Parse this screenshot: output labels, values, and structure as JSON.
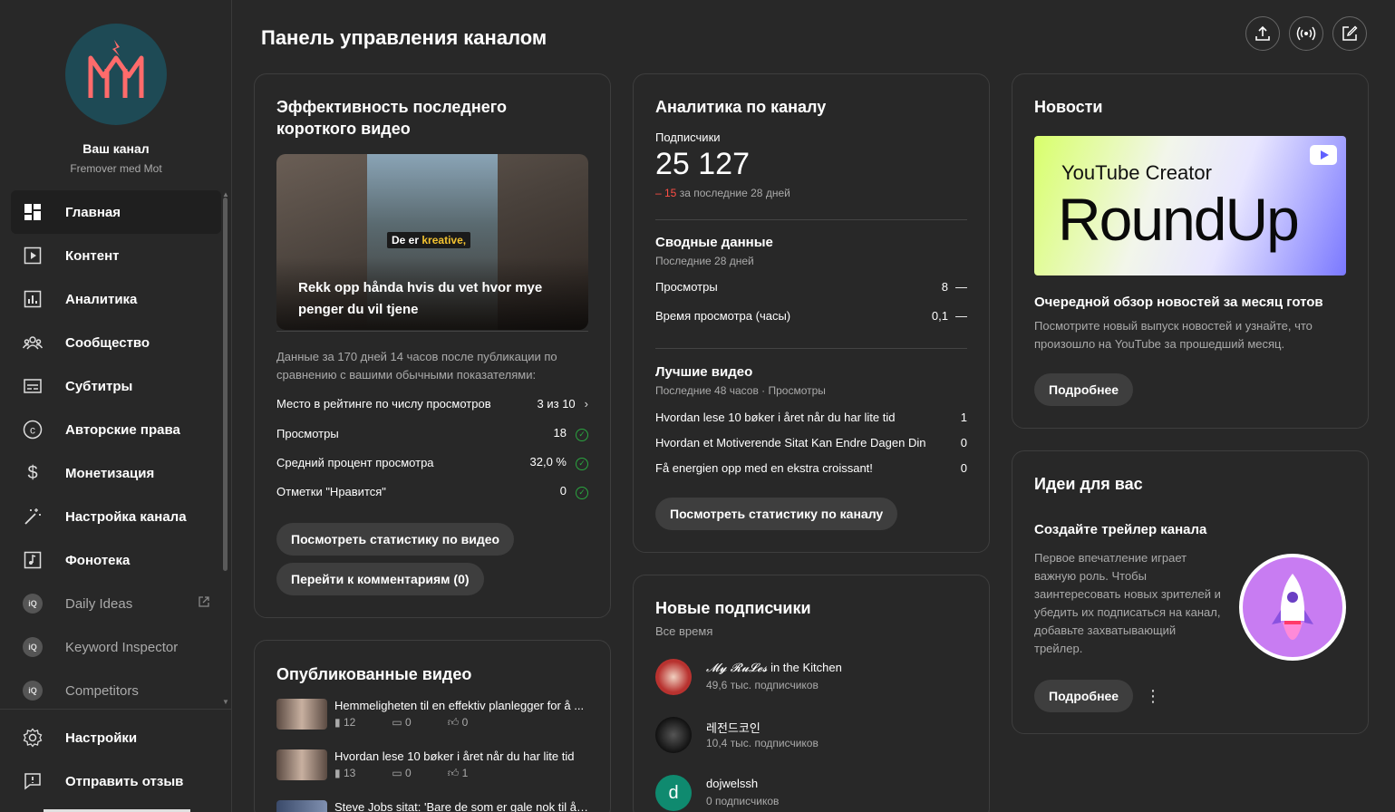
{
  "channel": {
    "name": "Ваш канал",
    "handle": "Fremover med Mot"
  },
  "nav": [
    {
      "label": "Главная",
      "icon": "dashboard-icon",
      "active": true
    },
    {
      "label": "Контент",
      "icon": "content-icon"
    },
    {
      "label": "Аналитика",
      "icon": "analytics-icon"
    },
    {
      "label": "Сообщество",
      "icon": "community-icon"
    },
    {
      "label": "Субтитры",
      "icon": "subtitles-icon"
    },
    {
      "label": "Авторские права",
      "icon": "copyright-icon"
    },
    {
      "label": "Монетизация",
      "icon": "monetization-icon"
    },
    {
      "label": "Настройка канала",
      "icon": "customization-icon"
    },
    {
      "label": "Фонотека",
      "icon": "audio-library-icon"
    },
    {
      "label": "Daily Ideas",
      "icon": "vidiq-icon",
      "external": true
    },
    {
      "label": "Keyword Inspector",
      "icon": "vidiq-icon"
    },
    {
      "label": "Competitors",
      "icon": "vidiq-icon"
    }
  ],
  "nav_bottom": [
    {
      "label": "Настройки",
      "icon": "settings-icon"
    },
    {
      "label": "Отправить отзыв",
      "icon": "feedback-icon"
    }
  ],
  "ext_badge": "iQ",
  "header": {
    "title": "Панель управления каналом"
  },
  "short_perf": {
    "title": "Эффективность последнего короткого видео",
    "thumb_overlay_prefix": "De er",
    "thumb_overlay_highlight": "kreative,",
    "thumb_caption": "Rekk opp hånda hvis du vet hvor mye penger du vil tjene",
    "description": "Данные за 170 дней 14 часов после публикации по сравнению с вашими обычными показателями:",
    "rows": [
      {
        "label": "Место в рейтинге по числу просмотров",
        "value": "3 из 10",
        "marker": "chevron"
      },
      {
        "label": "Просмотры",
        "value": "18",
        "marker": "check"
      },
      {
        "label": "Средний процент просмотра",
        "value": "32,0 %",
        "marker": "check"
      },
      {
        "label": "Отметки \"Нравится\"",
        "value": "0",
        "marker": "check"
      }
    ],
    "btn_stats": "Посмотреть статистику по видео",
    "btn_comments": "Перейти к комментариям (0)"
  },
  "published": {
    "title": "Опубликованные видео",
    "videos": [
      {
        "title": "Hemmeligheten til en effektiv planlegger for å ...",
        "views": "12",
        "comments": "0",
        "likes": "0"
      },
      {
        "title": "Hvordan lese 10 bøker i året når du har lite tid",
        "views": "13",
        "comments": "0",
        "likes": "1"
      },
      {
        "title": "Steve Jobs sitat: 'Bare de som er gale nok til å ...",
        "views": "",
        "comments": "",
        "likes": ""
      }
    ]
  },
  "analytics": {
    "title": "Аналитика по каналу",
    "subs_label": "Подписчики",
    "subs_value": "25 127",
    "subs_change": "– 15",
    "subs_change_suffix": "за последние 28 дней",
    "summary_title": "Сводные данные",
    "summary_sub": "Последние 28 дней",
    "summary_rows": [
      {
        "label": "Просмотры",
        "value": "8",
        "trend": "—"
      },
      {
        "label": "Время просмотра (часы)",
        "value": "0,1",
        "trend": "—"
      }
    ],
    "top_title": "Лучшие видео",
    "top_sub": "Последние 48 часов · Просмотры",
    "top_rows": [
      {
        "label": "Hvordan lese 10 bøker i året når du har lite tid",
        "value": "1"
      },
      {
        "label": "Hvordan et Motiverende Sitat Kan Endre Dagen Din",
        "value": "0"
      },
      {
        "label": "Få energien opp med en ekstra croissant!",
        "value": "0"
      }
    ],
    "btn": "Посмотреть статистику по каналу"
  },
  "new_subs": {
    "title": "Новые подписчики",
    "sub": "Все время",
    "items": [
      {
        "name_styled": "𝓜𝔂 𝓡𝓾𝓛𝓮𝓼",
        "name_rest": " in the Kitchen",
        "count": "49,6 тыс. подписчиков",
        "avatar_color": "#b8322f"
      },
      {
        "name_styled": "레전드코인",
        "name_rest": "",
        "count": "10,4 тыс. подписчиков",
        "avatar_color": "#222"
      },
      {
        "name_styled": "dojwelssh",
        "name_rest": "",
        "count": "0 подписчиков",
        "avatar_color": "#0f8a6f",
        "letter": "d"
      }
    ]
  },
  "news": {
    "title": "Новости",
    "banner_top": "YouTube Creator",
    "banner_main": "RoundUp",
    "headline": "Очередной обзор новостей за месяц готов",
    "body": "Посмотрите новый выпуск новостей и узнайте, что произошло на YouTube за прошедший месяц.",
    "btn": "Подробнее"
  },
  "ideas": {
    "title": "Идеи для вас",
    "headline": "Создайте трейлер канала",
    "body": "Первое впечатление играет важную роль. Чтобы заинтересовать новых зрителей и убедить их подписаться на канал, добавьте захватывающий трейлер.",
    "btn": "Подробнее"
  }
}
